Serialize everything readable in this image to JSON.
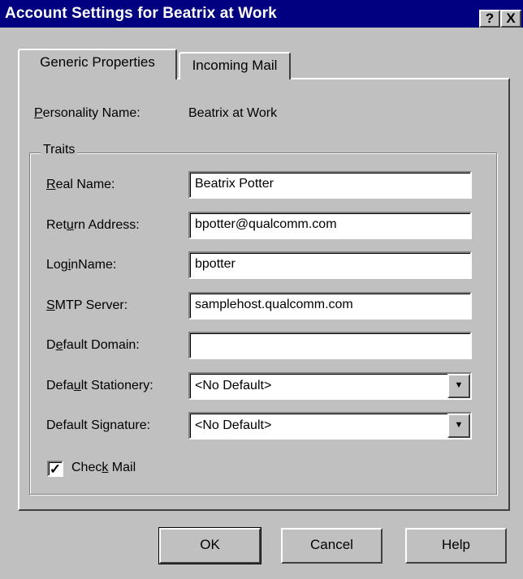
{
  "window": {
    "title": "Account Settings for Beatrix at Work",
    "help_glyph": "?",
    "close_glyph": "X"
  },
  "tabs": [
    {
      "label": "Generic Properties",
      "selected": true
    },
    {
      "label": "Incoming Mail",
      "selected": false
    }
  ],
  "personality": {
    "label": "Personality Name:",
    "value": "Beatrix at Work"
  },
  "traits": {
    "legend": "Traits",
    "real_name": {
      "label": "Real Name:",
      "value": "Beatrix Potter"
    },
    "return_address": {
      "label": "Return Address:",
      "value": "bpotter@qualcomm.com"
    },
    "login_name": {
      "label": "LoginName:",
      "value": "bpotter"
    },
    "smtp_server": {
      "label": "SMTP Server:",
      "value": "samplehost.qualcomm.com"
    },
    "default_domain": {
      "label": "Default Domain:",
      "value": ""
    },
    "default_stationery": {
      "label": "Default Stationery:",
      "value": "<No Default>"
    },
    "default_signature": {
      "label": "Default Signature:",
      "value": "<No Default>"
    },
    "check_mail": {
      "label": "Check Mail",
      "checked": true
    }
  },
  "buttons": {
    "ok": "OK",
    "cancel": "Cancel",
    "help": "Help"
  },
  "colors": {
    "titlebar": "#000080",
    "face": "#c0c0c0"
  }
}
